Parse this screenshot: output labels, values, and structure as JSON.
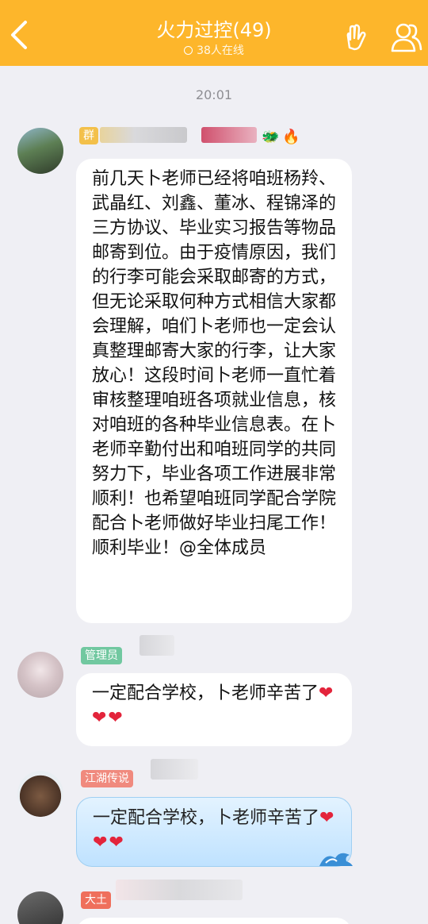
{
  "header": {
    "title": "火力过控(49)",
    "online": "38人在线",
    "bg_color": "#fdb62b"
  },
  "timestamp": "20:01",
  "messages": [
    {
      "tag": "群",
      "text": "前几天卜老师已经将咱班杨羚、武晶红、刘鑫、董冰、程锦泽的三方协议、毕业实习报告等物品邮寄到位。由于疫情原因，我们的行李可能会采取邮寄的方式，但无论采取何种方式相信大家都会理解，咱们卜老师也一定会认真整理邮寄大家的行李，让大家放心！这段时间卜老师一直忙着审核整理咱班各项就业信息，核对咱班的各种毕业信息表。在卜老师辛勤付出和咱班同学的共同努力下，毕业各项工作进展非常顺利！也希望咱班同学配合学院配合卜老师做好毕业扫尾工作！顺利毕业！@全体成员"
    },
    {
      "tag": "管理员",
      "text": "一定配合学校，卜老师辛苦了",
      "hearts": "❤❤❤"
    },
    {
      "tag": "江湖传说",
      "text": "一定配合学校，卜老师辛苦了",
      "hearts": "❤❤❤"
    },
    {
      "tag": "大土"
    }
  ]
}
